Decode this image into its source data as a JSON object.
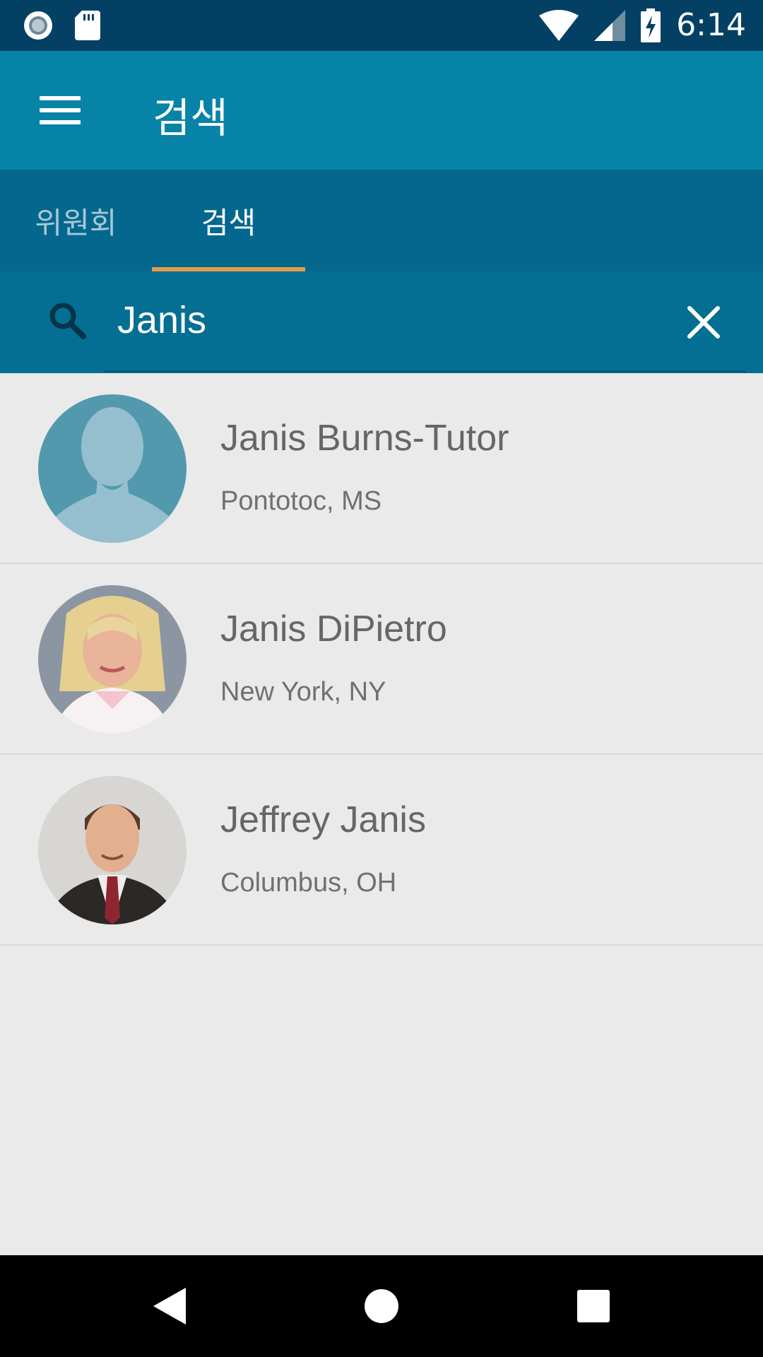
{
  "status_bar": {
    "time": "6:14"
  },
  "app_bar": {
    "title": "검색"
  },
  "tabs": [
    {
      "label": "위원회"
    },
    {
      "label": "검색"
    }
  ],
  "search": {
    "value": "Janis"
  },
  "results": [
    {
      "name": "Janis Burns-Tutor",
      "location": "Pontotoc, MS"
    },
    {
      "name": "Janis DiPietro",
      "location": "New York, NY"
    },
    {
      "name": "Jeffrey Janis",
      "location": "Columbus, OH"
    }
  ],
  "colors": {
    "status_bar": "#044063",
    "app_bar": "#0683a6",
    "tab_bar": "#04688e",
    "search_bar": "#046f93",
    "tab_indicator": "#e39b49",
    "list_background": "#eaeaea"
  },
  "icons": {
    "status_left": [
      "record-icon",
      "sd-card-icon"
    ],
    "status_right": [
      "wifi-icon",
      "cell-signal-icon",
      "battery-charging-icon"
    ],
    "nav": [
      "back-icon",
      "home-icon",
      "recents-icon"
    ]
  }
}
